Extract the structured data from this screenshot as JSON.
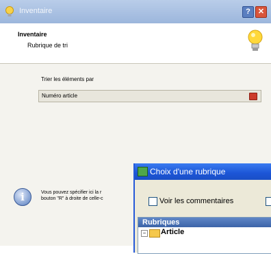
{
  "window": {
    "title": "Inventaire",
    "help_label": "?",
    "close_label": "✕",
    "icon": "bulb-icon"
  },
  "header": {
    "title": "Inventaire",
    "subtitle": "Rubrique de tri",
    "icon": "lightbulb-icon"
  },
  "sort": {
    "label": "Trier les éléments par",
    "value": "Numéro article",
    "button_icon": "dropdown-icon"
  },
  "info": {
    "icon": "info-icon",
    "icon_glyph": "i",
    "line1": "Vous pouvez spécifier ici la r",
    "line2": "bouton \"R\" à droite de celle-c"
  },
  "dialog": {
    "title": "Choix d'une rubrique",
    "show_comments_label": "Voir les commentaires",
    "tree_header": "Rubriques",
    "tree_item": "Article",
    "expander": "−"
  }
}
